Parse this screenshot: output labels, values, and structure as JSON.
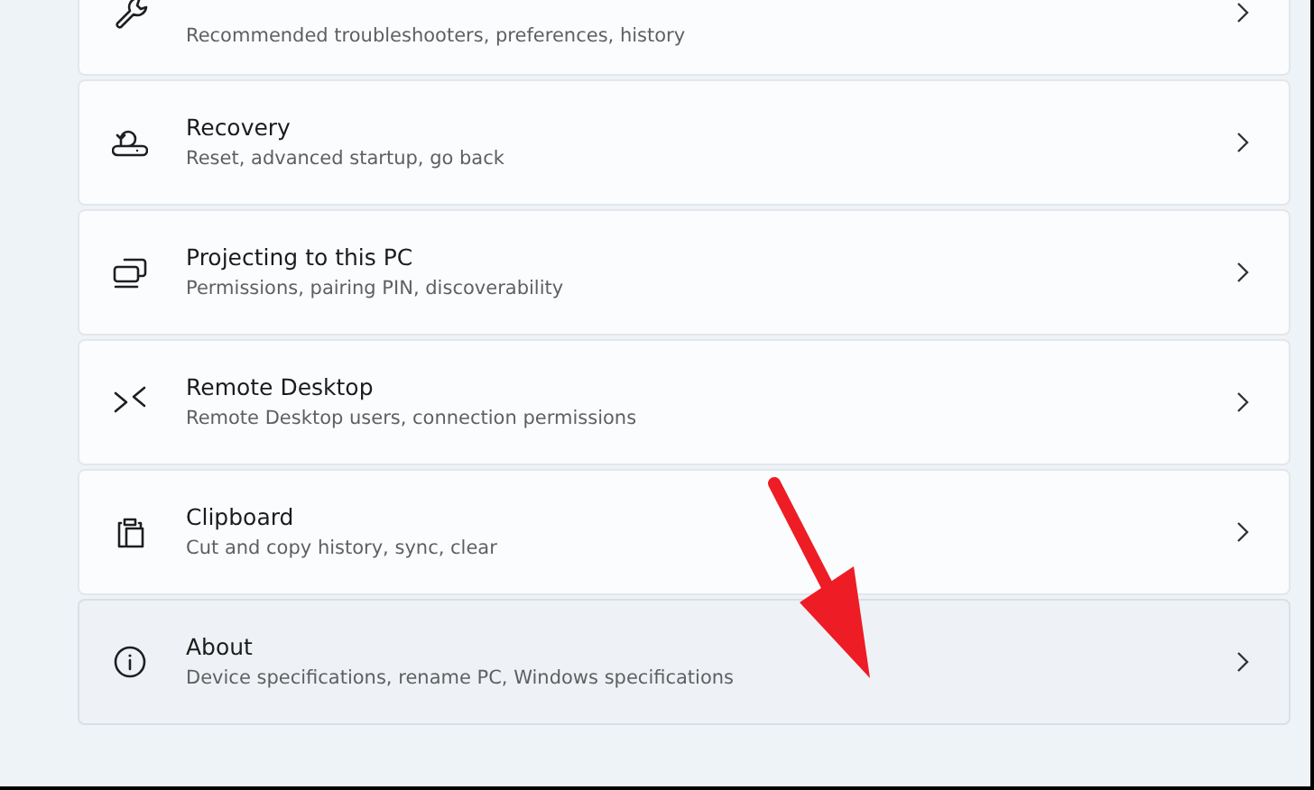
{
  "settings_items": [
    {
      "subtitle": "Recommended troubleshooters, preferences, history",
      "highlighted": false
    },
    {
      "title": "Recovery",
      "subtitle": "Reset, advanced startup, go back",
      "highlighted": false
    },
    {
      "title": "Projecting to this PC",
      "subtitle": "Permissions, pairing PIN, discoverability",
      "highlighted": false
    },
    {
      "title": "Remote Desktop",
      "subtitle": "Remote Desktop users, connection permissions",
      "highlighted": false
    },
    {
      "title": "Clipboard",
      "subtitle": "Cut and copy history, sync, clear",
      "highlighted": false
    },
    {
      "title": "About",
      "subtitle": "Device specifications, rename PC, Windows specifications",
      "highlighted": true
    }
  ]
}
